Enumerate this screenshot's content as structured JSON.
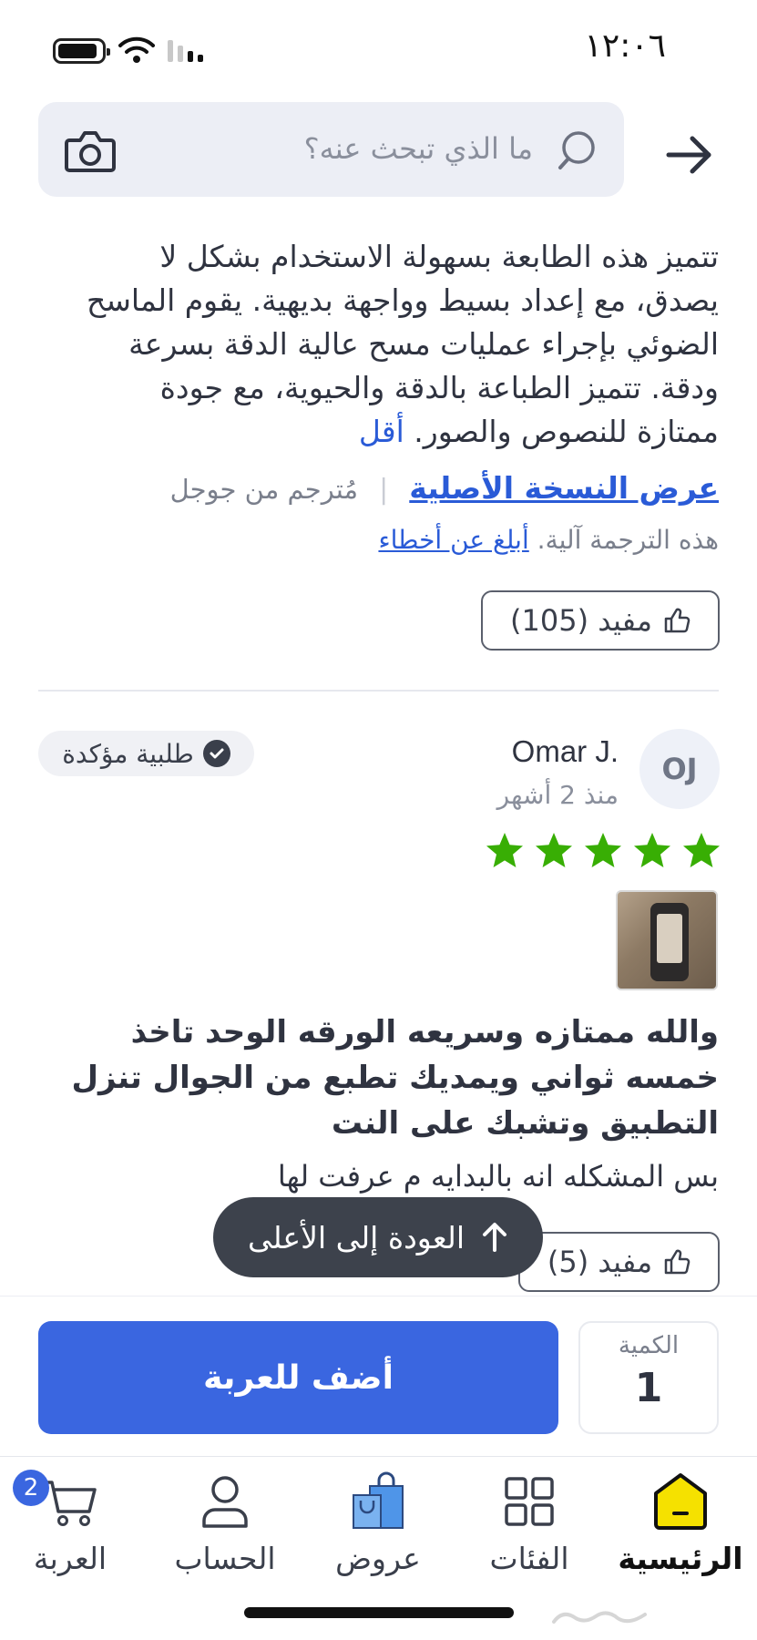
{
  "status": {
    "time": "١٢:٠٦"
  },
  "search": {
    "placeholder": "ما الذي تبحث عنه؟"
  },
  "review1": {
    "body": "تتميز هذه الطابعة بسهولة الاستخدام بشكل لا يصدق، مع إعداد بسيط وواجهة بديهية. يقوم الماسح الضوئي بإجراء عمليات مسح عالية الدقة بسرعة ودقة. تتميز الطباعة بالدقة والحيوية، مع جودة ممتازة للنصوص والصور.",
    "less": "أقل",
    "view_original": "عرض النسخة الأصلية",
    "translated_by": "مُترجم من جوجل",
    "auto_note": "هذه الترجمة آلية.",
    "report": "أبلغ عن أخطاء",
    "helpful": "مفيد (105)"
  },
  "review2": {
    "initials": "OJ",
    "name": "Omar J.",
    "date": "منذ 2 أشهر",
    "verified": "طلبية مؤكدة",
    "rating": 5,
    "title": "والله ممتازه وسريعه الورقه الوحد تاخذ خمسه ثواني ويمديك تطبع من الجوال تنزل التطبيق وتشبك على النت",
    "text": "بس المشكله انه بالبدايه م عرفت لها",
    "helpful": "مفيد (5)"
  },
  "back_to_top": "العودة إلى الأعلى",
  "actions": {
    "add_to_cart": "أضف للعربة",
    "qty_label": "الكمية",
    "qty_value": "1"
  },
  "tabs": {
    "home": "الرئيسية",
    "categories": "الفئات",
    "offers": "عروض",
    "account": "الحساب",
    "cart": "العربة",
    "cart_count": "2"
  },
  "colors": {
    "accent": "#3a66e0",
    "star": "#38ae04",
    "home_icon": "#f5e100"
  }
}
